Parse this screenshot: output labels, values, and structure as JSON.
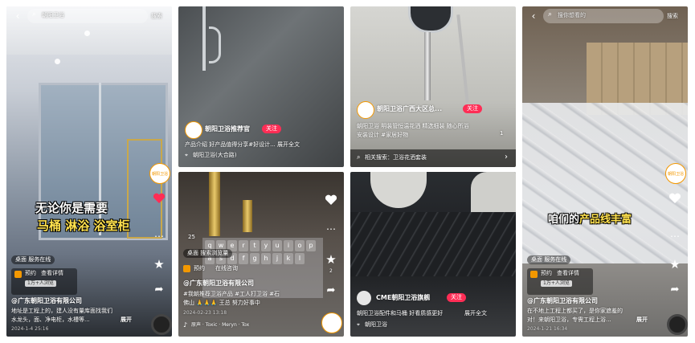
{
  "colors": {
    "accent": "#ff2d55",
    "caption_yellow": "#ffe14d",
    "logo_orange": "#f39800",
    "divider": "#ffffff"
  },
  "panel1": {
    "search_text": "朝阳卫浴",
    "search_button": "搜索",
    "caption_line1": "无论你是需要",
    "caption_line2a": "马桶 淋浴 ",
    "caption_line2b": "浴室柜",
    "tag": "桌面 服务在线",
    "service_label1": "预约",
    "service_label2": "查看详情",
    "badge": "1万+人浏览",
    "author": "@广东朝阳卫浴有限公司",
    "desc": "地址是工程上的，建人没有量库面找我们",
    "desc2": "水龙头，面、净电柜，水槽等...",
    "expand": "展开",
    "date": "2024-1-4 25:16",
    "logo_text": "朝阳卫浴"
  },
  "panel2": {
    "brand_name": "朝阳卫浴推荐官",
    "follow": "关注",
    "desc": "产品介绍 好产品值得分享#好设计... 展开全文",
    "location": "朝阳卫浴(大合路)"
  },
  "panel3": {
    "brand_name": "朝阳卫浴广西大区总...",
    "follow": "关注",
    "desc": "朝阳卫浴 明装管恒温花洒 精选细装 随心所浴",
    "desc2": "安装设计 #家居好物",
    "related": "相关搜索：卫浴花洒套装",
    "count": "1"
  },
  "panel4": {
    "count": "25",
    "tag": "桌面 搜索浏览量",
    "service1": "预约",
    "service2": "在线咨询",
    "author": "@广东朝阳卫浴有限公司",
    "desc": "#我朝推荐卫浴产品 #工人打卫浴 #石",
    "desc2": "佛山 🙏🙏🙏 王总 努力好事中",
    "date": "2024-02-23 13:18",
    "music": "原声 · Toxic · Meryn · Tox",
    "keys": [
      "q",
      "w",
      "e",
      "r",
      "t",
      "y",
      "u",
      "i",
      "o",
      "p",
      "a",
      "s",
      "d",
      "f",
      "g",
      "h",
      "j",
      "k",
      "l"
    ],
    "side_count": "2"
  },
  "panel5": {
    "brand_name": "CME朝阳卫浴旗舰",
    "follow": "关注",
    "desc": "朝阳卫浴配件和马桶 好看质感更好",
    "desc2": "展开全文",
    "location": "朝阳卫浴"
  },
  "panel6": {
    "search_placeholder": "搜你想看的",
    "search_button": "搜索",
    "caption_white": "咱们的",
    "caption_yellow": "产品线丰富",
    "tag": "桌面 服务在线",
    "service_label1": "预约",
    "service_label2": "查看详情",
    "badge": "1万+人浏览",
    "author": "@广东朝阳卫浴有限公司",
    "desc": "在不地上工程上都买了，是你家遮羞的",
    "desc2": "对！来朝阳卫浴，专需工程上浴...",
    "expand": "展开",
    "date": "2024-1-21 16:34",
    "logo_text": "朝阳卫浴"
  }
}
